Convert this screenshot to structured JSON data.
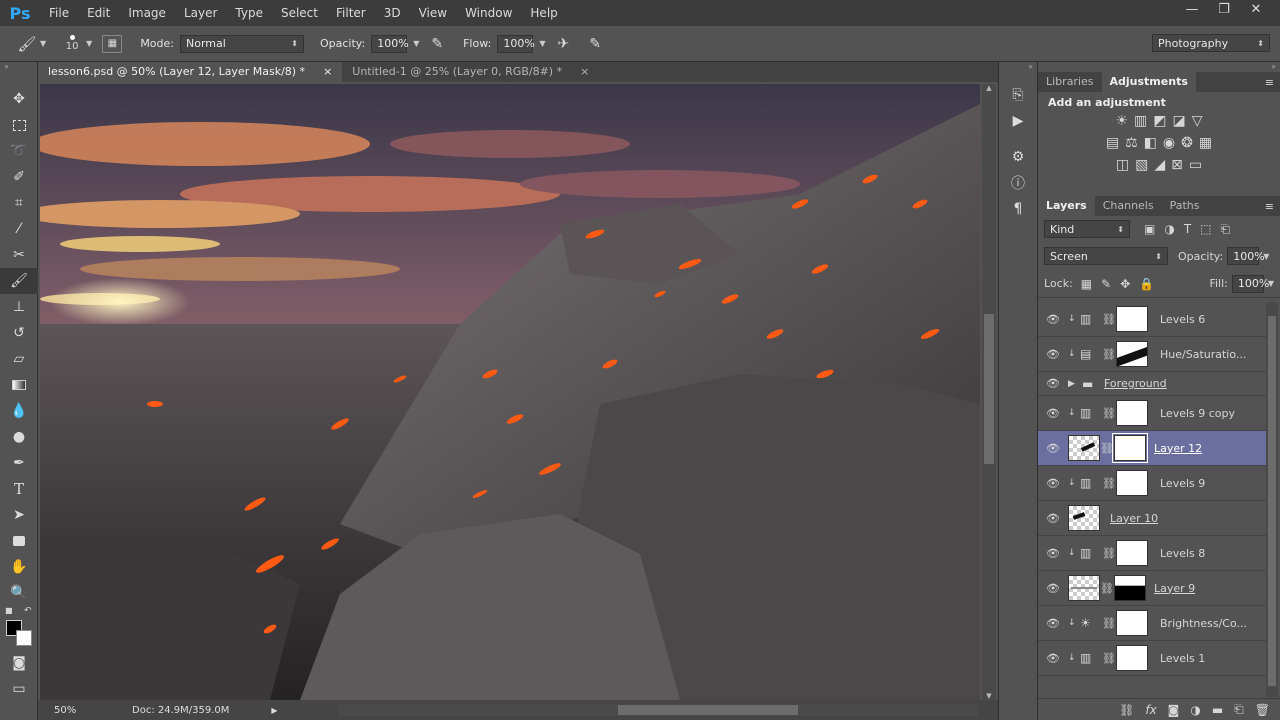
{
  "app": {
    "logo": "Ps"
  },
  "menu": [
    "File",
    "Edit",
    "Image",
    "Layer",
    "Type",
    "Select",
    "Filter",
    "3D",
    "View",
    "Window",
    "Help"
  ],
  "window_controls": {
    "minimize": "—",
    "restore": "❐",
    "close": "✕"
  },
  "options": {
    "brush_size": "10",
    "mode_label": "Mode:",
    "mode_value": "Normal",
    "opacity_label": "Opacity:",
    "opacity_value": "100%",
    "flow_label": "Flow:",
    "flow_value": "100%",
    "workspace": "Photography"
  },
  "tabs": [
    {
      "label": "lesson6.psd @ 50% (Layer 12, Layer Mask/8) *",
      "close": "×"
    },
    {
      "label": "Untitled-1 @ 25% (Layer 0, RGB/8#) *",
      "close": "×"
    }
  ],
  "status": {
    "zoom": "50%",
    "doc": "Doc: 24.9M/359.0M"
  },
  "panels": {
    "top_tabs": [
      "Libraries",
      "Adjustments"
    ],
    "adjust_title": "Add an adjustment",
    "layer_tabs": [
      "Layers",
      "Channels",
      "Paths"
    ],
    "kind": "Kind",
    "blend_mode": "Screen",
    "opacity_label": "Opacity:",
    "opacity_value": "100%",
    "lock_label": "Lock:",
    "fill_label": "Fill:",
    "fill_value": "100%"
  },
  "layers": [
    {
      "name": "Levels 6",
      "type": "adjustment"
    },
    {
      "name": "Hue/Saturatio...",
      "type": "adjustment-hue"
    },
    {
      "name": "Foreground",
      "type": "group"
    },
    {
      "name": "Levels 9 copy",
      "type": "adjustment"
    },
    {
      "name": "Layer 12",
      "type": "pixel-mask",
      "selected": true
    },
    {
      "name": "Levels 9",
      "type": "adjustment"
    },
    {
      "name": "Layer 10",
      "type": "pixel"
    },
    {
      "name": "Levels 8",
      "type": "adjustment"
    },
    {
      "name": "Layer 9",
      "type": "pixel-mask"
    },
    {
      "name": "Brightness/Co...",
      "type": "adjustment-bc"
    },
    {
      "name": "Levels 1",
      "type": "adjustment"
    }
  ],
  "colors": {
    "accent": "#31a8ff",
    "selection": "#6a6fa0",
    "lava": "#ff5a14"
  }
}
